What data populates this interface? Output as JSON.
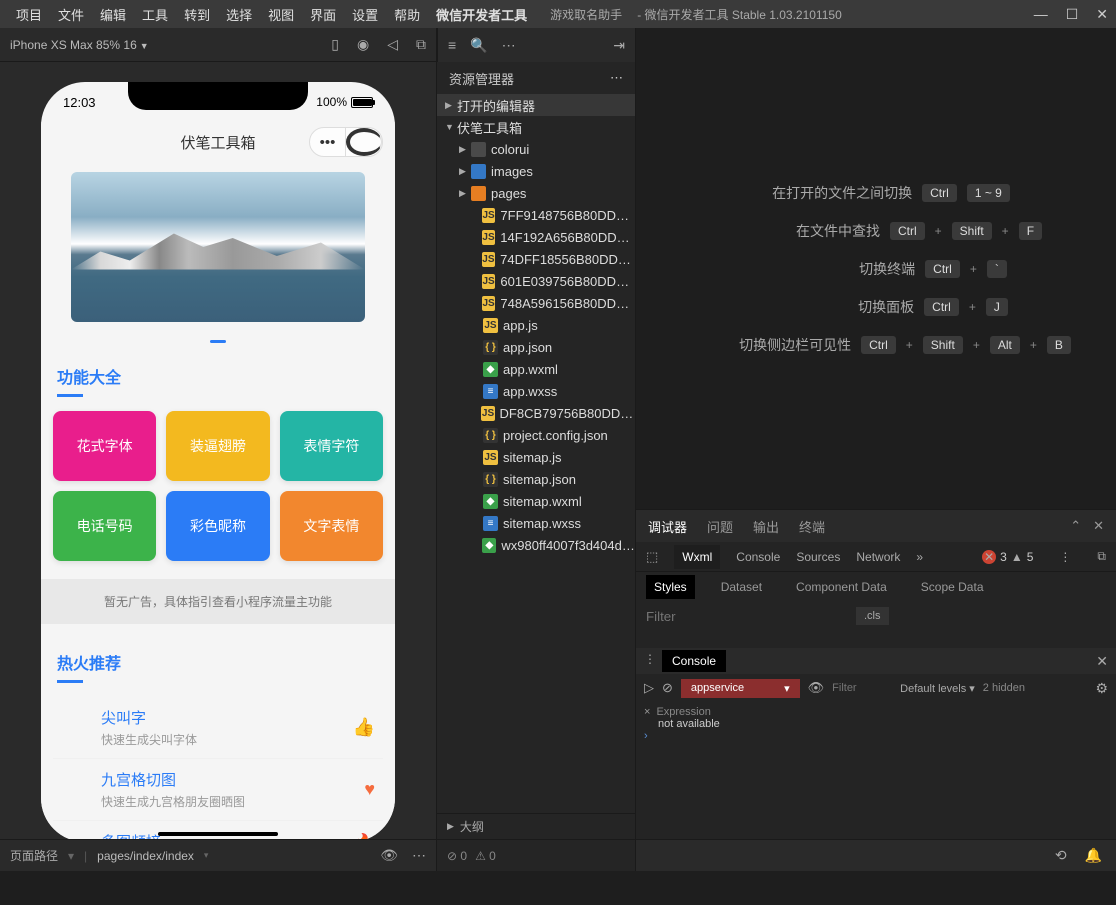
{
  "titlebar": {
    "menus": [
      "项目",
      "文件",
      "编辑",
      "工具",
      "转到",
      "选择",
      "视图",
      "界面",
      "设置",
      "帮助",
      "微信开发者工具"
    ],
    "project_name": "游戏取名助手",
    "app_version": "微信开发者工具 Stable 1.03.2101150"
  },
  "toolbar": {
    "device": "iPhone XS Max 85% 16"
  },
  "simulator": {
    "time": "12:03",
    "battery": "100%",
    "app_title": "伏笔工具箱",
    "section1": "功能大全",
    "tiles": [
      {
        "label": "花式字体",
        "color": "#e91e8c"
      },
      {
        "label": "装逼翅膀",
        "color": "#f3b91f"
      },
      {
        "label": "表情字符",
        "color": "#24b5a5"
      },
      {
        "label": "电话号码",
        "color": "#3cb34a"
      },
      {
        "label": "彩色昵称",
        "color": "#2b7cf6"
      },
      {
        "label": "文字表情",
        "color": "#f2872e"
      }
    ],
    "ad_text": "暂无广告，具体指引查看小程序流量主功能",
    "section2": "热火推荐",
    "list": [
      {
        "name": "尖叫字",
        "desc": "快速生成尖叫字体",
        "icon": "👍",
        "color": "#2b7cf6"
      },
      {
        "name": "九宫格切图",
        "desc": "快速生成九宫格朋友圈晒图",
        "icon": "♥",
        "color": "#f56c3e"
      },
      {
        "name": "多图频接",
        "desc": "",
        "icon": "🔥",
        "color": "#3cb34a"
      }
    ]
  },
  "footer": {
    "path_label": "页面路径",
    "path": "pages/index/index"
  },
  "explorer": {
    "title": "资源管理器",
    "sections": [
      "打开的编辑器",
      "伏笔工具箱"
    ],
    "folders": [
      "colorui",
      "images",
      "pages"
    ],
    "files": [
      {
        "name": "7FF9148756B80DDF19...",
        "type": "js"
      },
      {
        "name": "14F192A656B80DDF72...",
        "type": "js"
      },
      {
        "name": "74DFF18556B80DDF12...",
        "type": "js"
      },
      {
        "name": "601E039756B80DDF06...",
        "type": "js"
      },
      {
        "name": "748A596156B80DDF12...",
        "type": "js"
      },
      {
        "name": "app.js",
        "type": "js"
      },
      {
        "name": "app.json",
        "type": "json"
      },
      {
        "name": "app.wxml",
        "type": "wxml"
      },
      {
        "name": "app.wxss",
        "type": "wxss"
      },
      {
        "name": "DF8CB79756B80DDFB9...",
        "type": "js"
      },
      {
        "name": "project.config.json",
        "type": "json"
      },
      {
        "name": "sitemap.js",
        "type": "js"
      },
      {
        "name": "sitemap.json",
        "type": "json"
      },
      {
        "name": "sitemap.wxml",
        "type": "wxml"
      },
      {
        "name": "sitemap.wxss",
        "type": "wxss"
      },
      {
        "name": "wx980ff4007f3d404d.o...",
        "type": "wxml"
      }
    ],
    "outline": "大纲"
  },
  "center_footer": {
    "errors": "0",
    "warnings": "0"
  },
  "shortcuts": [
    {
      "label": "在打开的文件之间切换",
      "keys": [
        "Ctrl",
        "1 ~ 9"
      ]
    },
    {
      "label": "在文件中查找",
      "keys": [
        "Ctrl",
        "+",
        "Shift",
        "+",
        "F"
      ]
    },
    {
      "label": "切换终端",
      "keys": [
        "Ctrl",
        "+",
        "`"
      ]
    },
    {
      "label": "切换面板",
      "keys": [
        "Ctrl",
        "+",
        "J"
      ]
    },
    {
      "label": "切换侧边栏可见性",
      "keys": [
        "Ctrl",
        "+",
        "Shift",
        "+",
        "Alt",
        "+",
        "B"
      ]
    }
  ],
  "debugger": {
    "tabs": [
      "调试器",
      "问题",
      "输出",
      "终端"
    ],
    "devtabs": [
      "Wxml",
      "Console",
      "Sources",
      "Network"
    ],
    "errors": "3",
    "warnings": "5",
    "style_tabs": [
      "Styles",
      "Dataset",
      "Component Data",
      "Scope Data"
    ],
    "filter_placeholder": "Filter",
    "cls": ".cls",
    "console_tab": "Console",
    "context": "appservice",
    "filter2": "Filter",
    "levels": "Default levels ▾",
    "hidden": "2 hidden",
    "expr": "Expression",
    "na": "not available"
  }
}
